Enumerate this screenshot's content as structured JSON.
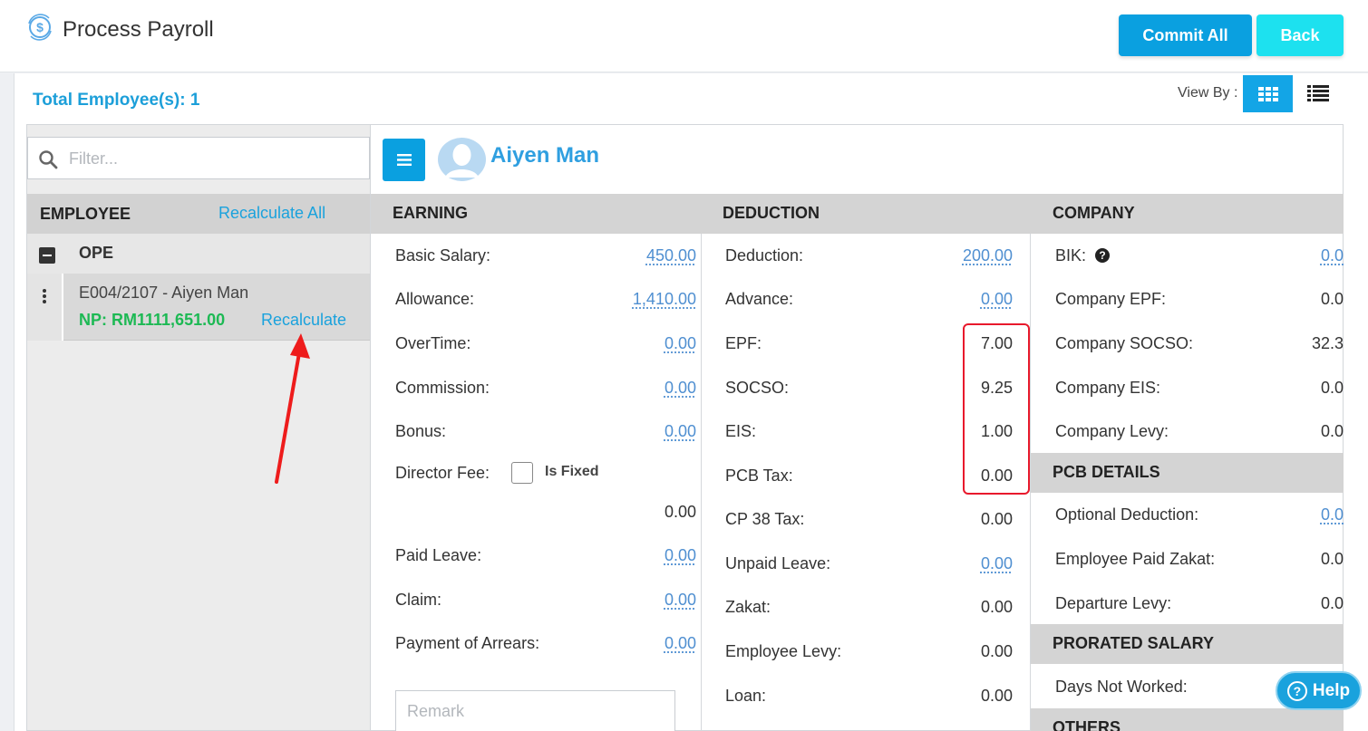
{
  "header": {
    "title": "Process Payroll",
    "commit_label": "Commit All",
    "back_label": "Back"
  },
  "summary": {
    "total_label": "Total Employee(s): 1",
    "view_by_label": "View By :"
  },
  "sidebar": {
    "filter_placeholder": "Filter...",
    "employee_header": "EMPLOYEE",
    "recalculate_all": "Recalculate All",
    "group_name": "OPE",
    "employee": {
      "name": "E004/2107 - Aiyen Man",
      "net_pay": "NP: RM1111,651.00",
      "recalculate": "Recalculate"
    }
  },
  "detail": {
    "person_name": "Aiyen Man",
    "remark_placeholder": "Remark",
    "earning": {
      "title": "EARNING",
      "rows": [
        {
          "label": "Basic Salary:",
          "value": "450.00"
        },
        {
          "label": "Allowance:",
          "value": "1,410.00"
        },
        {
          "label": "OverTime:",
          "value": "0.00"
        },
        {
          "label": "Commission:",
          "value": "0.00"
        },
        {
          "label": "Bonus:",
          "value": "0.00"
        },
        {
          "label": "Director Fee:",
          "is_fixed_label": "Is Fixed",
          "value": "0.00"
        },
        {
          "label": "Paid Leave:",
          "value": "0.00"
        },
        {
          "label": "Claim:",
          "value": "0.00"
        },
        {
          "label": "Payment of Arrears:",
          "value": "0.00"
        }
      ]
    },
    "deduction": {
      "title": "DEDUCTION",
      "rows": [
        {
          "label": "Deduction:",
          "value": "200.00"
        },
        {
          "label": "Advance:",
          "value": "0.00"
        },
        {
          "label": "EPF:",
          "value": "7.00"
        },
        {
          "label": "SOCSO:",
          "value": "9.25"
        },
        {
          "label": "EIS:",
          "value": "1.00"
        },
        {
          "label": "PCB Tax:",
          "value": "0.00"
        },
        {
          "label": "CP 38 Tax:",
          "value": "0.00"
        },
        {
          "label": "Unpaid Leave:",
          "value": "0.00"
        },
        {
          "label": "Zakat:",
          "value": "0.00"
        },
        {
          "label": "Employee Levy:",
          "value": "0.00"
        },
        {
          "label": "Loan:",
          "value": "0.00"
        }
      ]
    },
    "company": {
      "title": "COMPANY",
      "rows": [
        {
          "label": "BIK:",
          "value": "0.0"
        },
        {
          "label": "Company EPF:",
          "value": "0.0"
        },
        {
          "label": "Company SOCSO:",
          "value": "32.3"
        },
        {
          "label": "Company EIS:",
          "value": "0.0"
        },
        {
          "label": "Company Levy:",
          "value": "0.0"
        }
      ]
    },
    "pcb_details": {
      "title": "PCB DETAILS",
      "rows": [
        {
          "label": "Optional Deduction:",
          "value": "0.0"
        },
        {
          "label": "Employee Paid Zakat:",
          "value": "0.0"
        },
        {
          "label": "Departure Levy:",
          "value": "0.0"
        }
      ]
    },
    "prorated_salary": {
      "title": "PRORATED SALARY",
      "rows": [
        {
          "label": "Days Not Worked:"
        }
      ]
    },
    "others_title": "OTHERS"
  },
  "help_label": "Help",
  "colors": {
    "primary": "#0aa0e0",
    "back_button": "#1de1ef",
    "link": "#1aa2dd",
    "net_pay": "#1db954",
    "highlight": "#e8192c"
  }
}
